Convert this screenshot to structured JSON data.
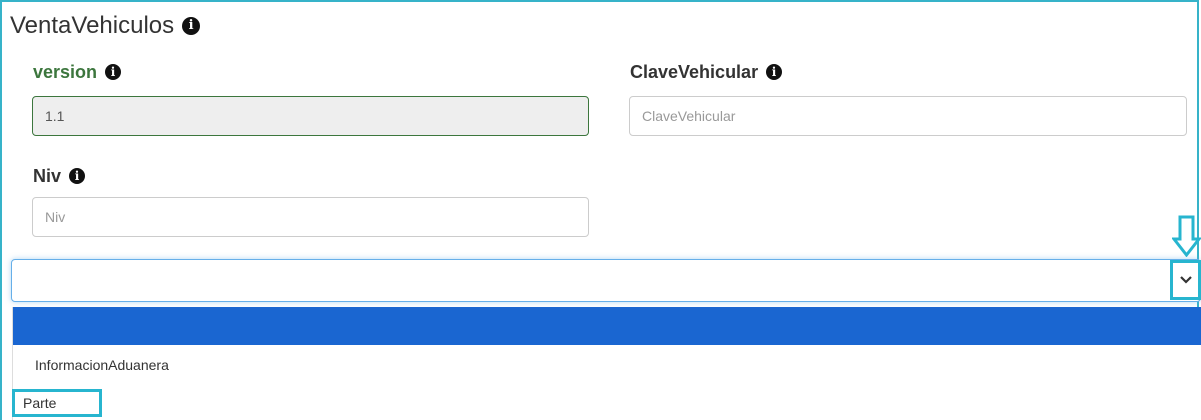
{
  "section": {
    "title": "VentaVehiculos",
    "info_icon": "info-circle-icon"
  },
  "fields": {
    "version": {
      "label": "version",
      "value": "1.1",
      "placeholder": ""
    },
    "clave_vehicular": {
      "label": "ClaveVehicular",
      "value": "",
      "placeholder": "ClaveVehicular"
    },
    "niv": {
      "label": "Niv",
      "value": "",
      "placeholder": "Niv"
    }
  },
  "select": {
    "selected_value": "",
    "icon": "chevron-down-icon",
    "options": [
      "InformacionAduanera",
      "Parte"
    ]
  },
  "colors": {
    "accent": "#27b5cf",
    "header_blue": "#1a66d1",
    "success_green": "#3c763d"
  }
}
